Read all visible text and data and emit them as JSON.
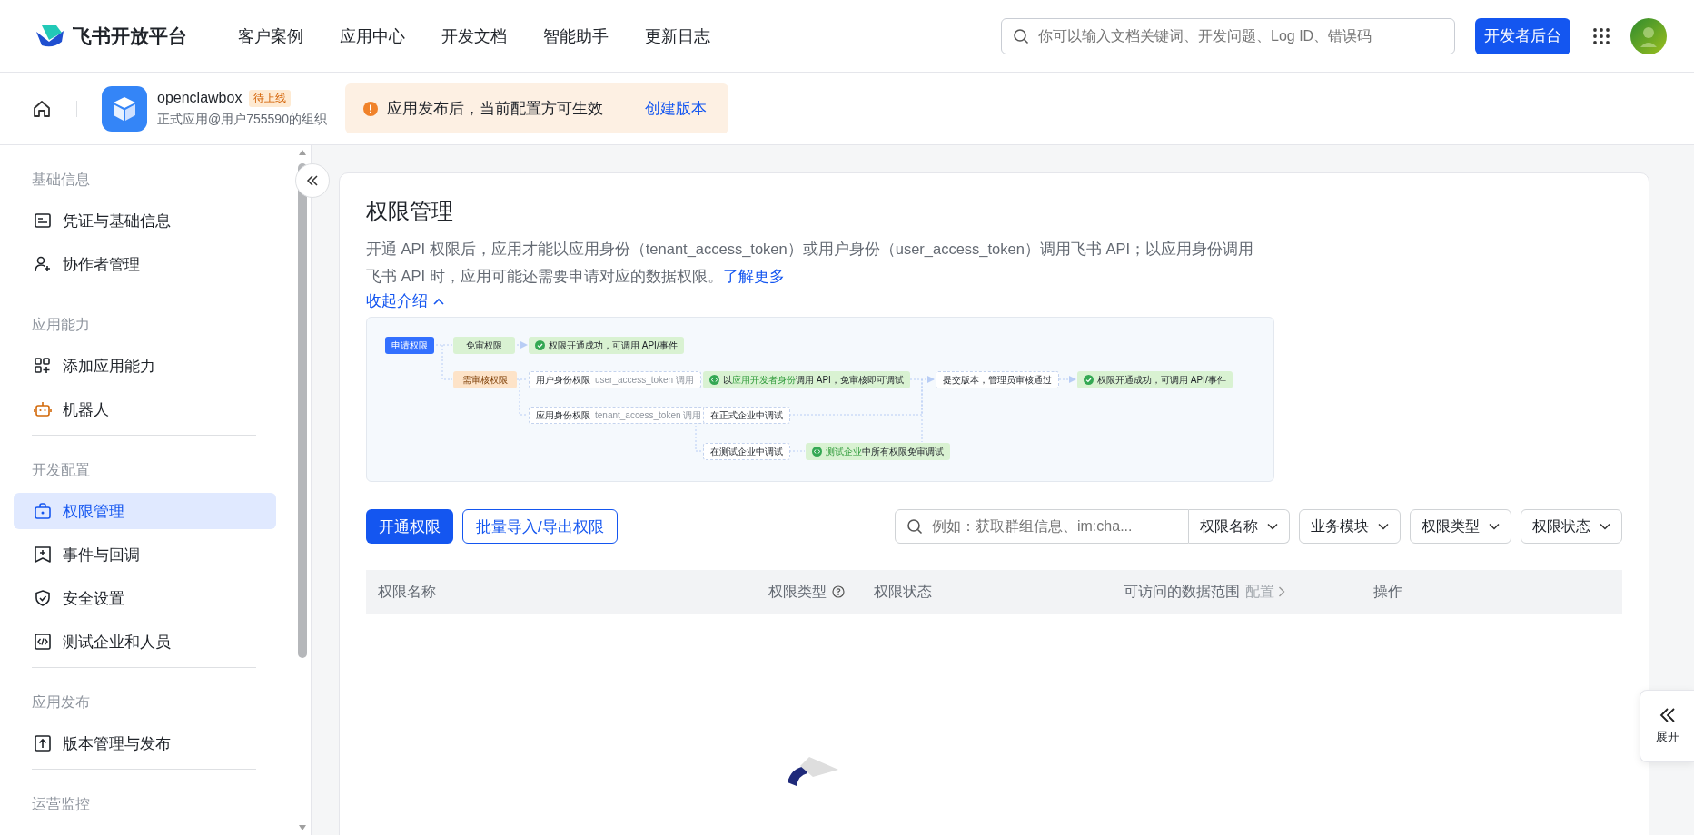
{
  "header": {
    "logo_text": "飞书开放平台",
    "nav": [
      "客户案例",
      "应用中心",
      "开发文档",
      "智能助手",
      "更新日志"
    ],
    "search": {
      "placeholder": "你可以输入文档关键词、开发问题、Log ID、错误码"
    },
    "console_button": "开发者后台"
  },
  "app_bar": {
    "app_name": "openclawbox",
    "status_badge": "待上线",
    "org": "正式应用@用户755590的组织",
    "notice": {
      "text": "应用发布后，当前配置方可生效",
      "link": "创建版本"
    }
  },
  "sidebar": {
    "groups": [
      {
        "heading": "基础信息",
        "items": [
          {
            "label": "凭证与基础信息",
            "selected": false
          },
          {
            "label": "协作者管理",
            "selected": false
          }
        ]
      },
      {
        "heading": "应用能力",
        "items": [
          {
            "label": "添加应用能力",
            "selected": false
          },
          {
            "label": "机器人",
            "selected": false
          }
        ]
      },
      {
        "heading": "开发配置",
        "items": [
          {
            "label": "权限管理",
            "selected": true
          },
          {
            "label": "事件与回调",
            "selected": false
          },
          {
            "label": "安全设置",
            "selected": false
          },
          {
            "label": "测试企业和人员",
            "selected": false
          }
        ]
      },
      {
        "heading": "应用发布",
        "items": [
          {
            "label": "版本管理与发布",
            "selected": false
          }
        ]
      },
      {
        "heading": "运营监控"
      }
    ]
  },
  "page": {
    "title": "权限管理",
    "description": "开通 API 权限后，应用才能以应用身份（tenant_access_token）或用户身份（user_access_token）调用飞书 API；以应用身份调用飞书 API 时，应用可能还需要申请对应的数据权限。",
    "learn_more": "了解更多",
    "collapse_link": "收起介绍",
    "flow": {
      "nodes": [
        {
          "kind": "primary",
          "parts": [
            {
              "text": "申请权限",
              "kind": "normal"
            }
          ]
        },
        {
          "kind": "pass",
          "parts": [
            {
              "text": "免审权限",
              "kind": "normal"
            }
          ]
        },
        {
          "kind": "success",
          "parts": [
            {
              "text": "权限开通成功，可调用 API/事件",
              "kind": "normal"
            }
          ]
        },
        {
          "kind": "review",
          "parts": [
            {
              "text": "需审核权限",
              "kind": "normal"
            }
          ]
        },
        {
          "kind": "step",
          "parts": [
            {
              "text": "用户身份权限",
              "kind": "normal"
            },
            {
              "text": "user_access_token 调用",
              "kind": "minor"
            }
          ]
        },
        {
          "kind": "debug",
          "parts": [
            {
              "text": "以",
              "kind": "normal"
            },
            {
              "text": "应用开发者身份",
              "kind": "highlight"
            },
            {
              "text": "调用 API，免审核即可调试",
              "kind": "normal"
            }
          ]
        },
        {
          "kind": "step",
          "parts": [
            {
              "text": "提交版本，管理员审核通过",
              "kind": "normal"
            }
          ]
        },
        {
          "kind": "success",
          "parts": [
            {
              "text": "权限开通成功，可调用 API/事件",
              "kind": "normal"
            }
          ]
        },
        {
          "kind": "step",
          "parts": [
            {
              "text": "应用身份权限",
              "kind": "normal"
            },
            {
              "text": "tenant_access_token 调用",
              "kind": "minor"
            }
          ]
        },
        {
          "kind": "step",
          "parts": [
            {
              "text": "在正式企业中调试",
              "kind": "normal"
            }
          ]
        },
        {
          "kind": "step",
          "parts": [
            {
              "text": "在测试企业中调试",
              "kind": "normal"
            }
          ]
        },
        {
          "kind": "debug",
          "parts": [
            {
              "text": "测试企业",
              "kind": "highlight"
            },
            {
              "text": "中所有权限免审调试",
              "kind": "normal"
            }
          ]
        }
      ]
    },
    "actions": [
      {
        "label": "开通权限",
        "kind": "primary"
      },
      {
        "label": "批量导入/导出权限",
        "kind": "outline"
      }
    ],
    "search": {
      "placeholder": "例如：获取群组信息、im:cha...",
      "field_select": "权限名称"
    },
    "filters": [
      "业务模块",
      "权限类型",
      "权限状态"
    ],
    "table": {
      "columns": [
        {
          "label": "权限名称"
        },
        {
          "label": "权限类型",
          "help": true
        },
        {
          "label": "权限状态"
        },
        {
          "label": "可访问的数据范围",
          "link": "配置"
        },
        {
          "label": "操作"
        }
      ]
    }
  },
  "expand_panel": {
    "label": "展开"
  }
}
